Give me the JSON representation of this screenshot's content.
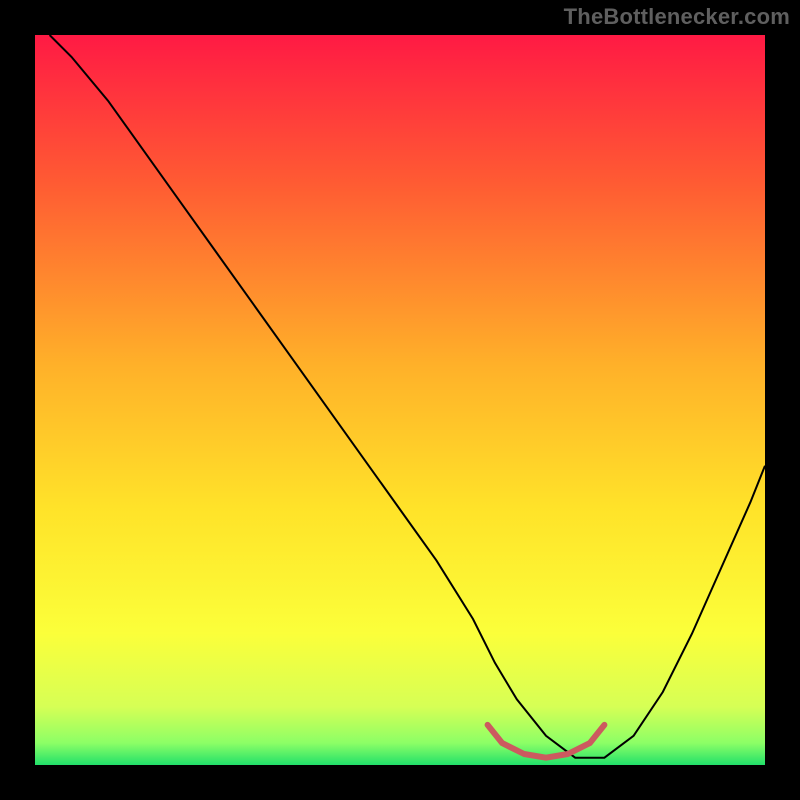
{
  "watermark": "TheBottleneсker.com",
  "chart_data": {
    "type": "line",
    "title": "",
    "xlabel": "",
    "ylabel": "",
    "xlim": [
      0,
      100
    ],
    "ylim": [
      0,
      100
    ],
    "grid": false,
    "legend": false,
    "background_gradient_stops": [
      {
        "offset": 0.0,
        "color": "#ff1a44"
      },
      {
        "offset": 0.2,
        "color": "#ff5a33"
      },
      {
        "offset": 0.45,
        "color": "#ffb029"
      },
      {
        "offset": 0.65,
        "color": "#ffe329"
      },
      {
        "offset": 0.82,
        "color": "#fbff3a"
      },
      {
        "offset": 0.92,
        "color": "#d6ff55"
      },
      {
        "offset": 0.97,
        "color": "#8cff66"
      },
      {
        "offset": 1.0,
        "color": "#22e06a"
      }
    ],
    "series": [
      {
        "name": "bottleneck-curve",
        "color": "#000000",
        "width": 2,
        "x": [
          2,
          5,
          10,
          15,
          20,
          25,
          30,
          35,
          40,
          45,
          50,
          55,
          60,
          63,
          66,
          70,
          74,
          78,
          82,
          86,
          90,
          94,
          98,
          100
        ],
        "y": [
          100,
          97,
          91,
          84,
          77,
          70,
          63,
          56,
          49,
          42,
          35,
          28,
          20,
          14,
          9,
          4,
          1,
          1,
          4,
          10,
          18,
          27,
          36,
          41
        ]
      },
      {
        "name": "optimal-zone",
        "color": "#cc5a5f",
        "width": 6,
        "x": [
          62,
          64,
          67,
          70,
          73,
          76,
          78
        ],
        "y": [
          5.5,
          3.0,
          1.5,
          1.0,
          1.5,
          3.0,
          5.5
        ]
      }
    ]
  }
}
